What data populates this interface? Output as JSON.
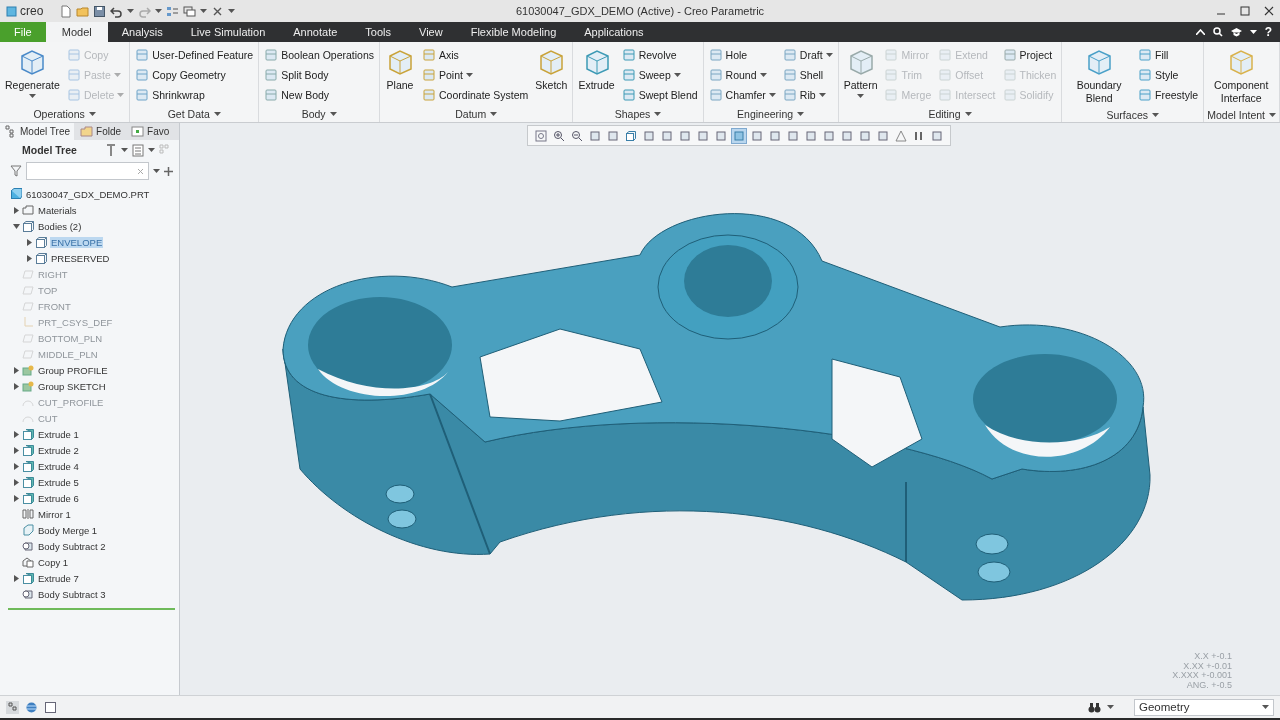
{
  "window": {
    "logo": "creo",
    "title": "61030047_GDX_DEMO (Active) - Creo Parametric"
  },
  "menu_tabs": [
    {
      "label": "File",
      "kind": "file",
      "selected": false
    },
    {
      "label": "Model",
      "kind": "tab",
      "selected": true
    },
    {
      "label": "Analysis",
      "kind": "tab",
      "selected": false
    },
    {
      "label": "Live Simulation",
      "kind": "tab",
      "selected": false
    },
    {
      "label": "Annotate",
      "kind": "tab",
      "selected": false
    },
    {
      "label": "Tools",
      "kind": "tab",
      "selected": false
    },
    {
      "label": "View",
      "kind": "tab",
      "selected": false
    },
    {
      "label": "Flexible Modeling",
      "kind": "tab",
      "selected": false
    },
    {
      "label": "Applications",
      "kind": "tab",
      "selected": false
    }
  ],
  "help": "?",
  "ribbon_groups": [
    {
      "label": "Operations",
      "columns": [
        [
          {
            "label": "Regenerate",
            "kind": "large",
            "disabled": false,
            "dropdown": true
          }
        ],
        [
          {
            "label": "Copy",
            "kind": "small",
            "disabled": true,
            "dropdown": false
          },
          {
            "label": "Paste",
            "kind": "small",
            "disabled": true,
            "dropdown": true
          },
          {
            "label": "Delete",
            "kind": "small",
            "disabled": true,
            "dropdown": true
          }
        ]
      ]
    },
    {
      "label": "Get Data",
      "columns": [
        [
          {
            "label": "User-Defined Feature",
            "kind": "small",
            "disabled": false,
            "dropdown": false
          },
          {
            "label": "Copy Geometry",
            "kind": "small",
            "disabled": false,
            "dropdown": false
          },
          {
            "label": "Shrinkwrap",
            "kind": "small",
            "disabled": false,
            "dropdown": false
          }
        ]
      ]
    },
    {
      "label": "Body",
      "columns": [
        [
          {
            "label": "Boolean Operations",
            "kind": "small",
            "disabled": false,
            "dropdown": false
          },
          {
            "label": "Split Body",
            "kind": "small",
            "disabled": false,
            "dropdown": false
          },
          {
            "label": "New Body",
            "kind": "small",
            "disabled": false,
            "dropdown": false
          }
        ]
      ]
    },
    {
      "label": "Datum",
      "columns": [
        [
          {
            "label": "Plane",
            "kind": "large",
            "disabled": false,
            "dropdown": false
          }
        ],
        [
          {
            "label": "Axis",
            "kind": "small",
            "disabled": false,
            "dropdown": false
          },
          {
            "label": "Point",
            "kind": "small",
            "disabled": false,
            "dropdown": true
          },
          {
            "label": "Coordinate System",
            "kind": "small",
            "disabled": false,
            "dropdown": false
          }
        ],
        [
          {
            "label": "Sketch",
            "kind": "large",
            "disabled": false,
            "dropdown": false
          }
        ]
      ]
    },
    {
      "label": "Shapes",
      "columns": [
        [
          {
            "label": "Extrude",
            "kind": "large",
            "disabled": false,
            "dropdown": false
          }
        ],
        [
          {
            "label": "Revolve",
            "kind": "small",
            "disabled": false,
            "dropdown": false
          },
          {
            "label": "Sweep",
            "kind": "small",
            "disabled": false,
            "dropdown": true
          },
          {
            "label": "Swept Blend",
            "kind": "small",
            "disabled": false,
            "dropdown": false
          }
        ]
      ]
    },
    {
      "label": "Engineering",
      "columns": [
        [
          {
            "label": "Hole",
            "kind": "small",
            "disabled": false,
            "dropdown": false
          },
          {
            "label": "Round",
            "kind": "small",
            "disabled": false,
            "dropdown": true
          },
          {
            "label": "Chamfer",
            "kind": "small",
            "disabled": false,
            "dropdown": true
          }
        ],
        [
          {
            "label": "Draft",
            "kind": "small",
            "disabled": false,
            "dropdown": true
          },
          {
            "label": "Shell",
            "kind": "small",
            "disabled": false,
            "dropdown": false
          },
          {
            "label": "Rib",
            "kind": "small",
            "disabled": false,
            "dropdown": true
          }
        ]
      ]
    },
    {
      "label": "Editing",
      "columns": [
        [
          {
            "label": "Pattern",
            "kind": "large",
            "disabled": false,
            "dropdown": true
          }
        ],
        [
          {
            "label": "Mirror",
            "kind": "small",
            "disabled": true,
            "dropdown": false
          },
          {
            "label": "Trim",
            "kind": "small",
            "disabled": true,
            "dropdown": false
          },
          {
            "label": "Merge",
            "kind": "small",
            "disabled": true,
            "dropdown": false
          }
        ],
        [
          {
            "label": "Extend",
            "kind": "small",
            "disabled": true,
            "dropdown": false
          },
          {
            "label": "Offset",
            "kind": "small",
            "disabled": true,
            "dropdown": false
          },
          {
            "label": "Intersect",
            "kind": "small",
            "disabled": true,
            "dropdown": false
          }
        ],
        [
          {
            "label": "Project",
            "kind": "small",
            "disabled": false,
            "dropdown": false
          },
          {
            "label": "Thicken",
            "kind": "small",
            "disabled": true,
            "dropdown": false
          },
          {
            "label": "Solidify",
            "kind": "small",
            "disabled": true,
            "dropdown": false
          }
        ]
      ]
    },
    {
      "label": "Surfaces",
      "columns": [
        [
          {
            "label": "Boundary Blend",
            "kind": "large",
            "disabled": false,
            "dropdown": false
          }
        ],
        [
          {
            "label": "Fill",
            "kind": "small",
            "disabled": false,
            "dropdown": false
          },
          {
            "label": "Style",
            "kind": "small",
            "disabled": false,
            "dropdown": false
          },
          {
            "label": "Freestyle",
            "kind": "small",
            "disabled": false,
            "dropdown": false
          }
        ]
      ]
    },
    {
      "label": "Model Intent",
      "columns": [
        [
          {
            "label": "Component Interface",
            "kind": "large",
            "disabled": false,
            "dropdown": false
          }
        ]
      ]
    }
  ],
  "panel_tabs": [
    {
      "label": "Model Tree",
      "selected": true
    },
    {
      "label": "Folde",
      "selected": false
    },
    {
      "label": "Favo",
      "selected": false
    }
  ],
  "tree_header": "Model Tree",
  "tree": {
    "label": "61030047_GDX_DEMO.PRT",
    "kind": "part",
    "dimmed": false,
    "selected": false,
    "children": [
      {
        "label": "Materials",
        "kind": "folder",
        "dimmed": false,
        "selected": false,
        "expanded": false
      },
      {
        "label": "Bodies (2)",
        "kind": "body",
        "dimmed": false,
        "selected": false,
        "expanded": true,
        "children": [
          {
            "label": "ENVELOPE",
            "kind": "body",
            "dimmed": false,
            "selected": true,
            "expanded": false
          },
          {
            "label": "PRESERVED",
            "kind": "body",
            "dimmed": false,
            "selected": false,
            "expanded": false
          }
        ]
      },
      {
        "label": "RIGHT",
        "kind": "plane",
        "dimmed": true,
        "selected": false
      },
      {
        "label": "TOP",
        "kind": "plane",
        "dimmed": true,
        "selected": false
      },
      {
        "label": "FRONT",
        "kind": "plane",
        "dimmed": true,
        "selected": false
      },
      {
        "label": "PRT_CSYS_DEF",
        "kind": "csys",
        "dimmed": true,
        "selected": false
      },
      {
        "label": "BOTTOM_PLN",
        "kind": "plane",
        "dimmed": true,
        "selected": false
      },
      {
        "label": "MIDDLE_PLN",
        "kind": "plane",
        "dimmed": true,
        "selected": false
      },
      {
        "label": "Group PROFILE",
        "kind": "group",
        "dimmed": false,
        "selected": false,
        "expanded": false
      },
      {
        "label": "Group SKETCH",
        "kind": "group",
        "dimmed": false,
        "selected": false,
        "expanded": false
      },
      {
        "label": "CUT_PROFILE",
        "kind": "sketch",
        "dimmed": true,
        "selected": false
      },
      {
        "label": "CUT",
        "kind": "sketch",
        "dimmed": true,
        "selected": false
      },
      {
        "label": "Extrude 1",
        "kind": "extrude",
        "dimmed": false,
        "selected": false,
        "expanded": false
      },
      {
        "label": "Extrude 2",
        "kind": "extrude",
        "dimmed": false,
        "selected": false,
        "expanded": false
      },
      {
        "label": "Extrude 4",
        "kind": "extrude",
        "dimmed": false,
        "selected": false,
        "expanded": false
      },
      {
        "label": "Extrude 5",
        "kind": "extrude",
        "dimmed": false,
        "selected": false,
        "expanded": false
      },
      {
        "label": "Extrude 6",
        "kind": "extrude",
        "dimmed": false,
        "selected": false,
        "expanded": false
      },
      {
        "label": "Mirror 1",
        "kind": "mirror",
        "dimmed": false,
        "selected": false
      },
      {
        "label": "Body Merge 1",
        "kind": "merge",
        "dimmed": false,
        "selected": false
      },
      {
        "label": "Body Subtract 2",
        "kind": "subtract",
        "dimmed": false,
        "selected": false
      },
      {
        "label": "Copy 1",
        "kind": "copy",
        "dimmed": false,
        "selected": false
      },
      {
        "label": "Extrude 7",
        "kind": "extrude",
        "dimmed": false,
        "selected": false,
        "expanded": false
      },
      {
        "label": "Body Subtract 3",
        "kind": "subtract",
        "dimmed": false,
        "selected": false
      }
    ]
  },
  "graphics_toolbar": [
    {
      "kind": "zoom-fit",
      "on": false
    },
    {
      "kind": "zoom-in",
      "on": false
    },
    {
      "kind": "zoom-out",
      "on": false
    },
    {
      "kind": "repaint",
      "on": false
    },
    {
      "kind": "spin",
      "on": false
    },
    {
      "kind": "cube",
      "on": false
    },
    {
      "kind": "view",
      "on": false
    },
    {
      "kind": "section",
      "on": false
    },
    {
      "kind": "prev",
      "on": false
    },
    {
      "kind": "next",
      "on": false
    },
    {
      "kind": "appearance",
      "on": false
    },
    {
      "kind": "shade",
      "on": true
    },
    {
      "kind": "plane",
      "on": false
    },
    {
      "kind": "axis",
      "on": false
    },
    {
      "kind": "point",
      "on": false
    },
    {
      "kind": "csys",
      "on": false
    },
    {
      "kind": "annot",
      "on": false
    },
    {
      "kind": "note",
      "on": false
    },
    {
      "kind": "tag",
      "on": false
    },
    {
      "kind": "cut",
      "on": false
    },
    {
      "kind": "warn",
      "on": false
    },
    {
      "kind": "pause",
      "on": false
    },
    {
      "kind": "rebuild",
      "on": false
    }
  ],
  "tolerances": [
    "X.X +-0.1",
    "X.XX +-0.01",
    "X.XXX +-0.001",
    "ANG. +-0.5"
  ],
  "selection_filter": "Geometry"
}
